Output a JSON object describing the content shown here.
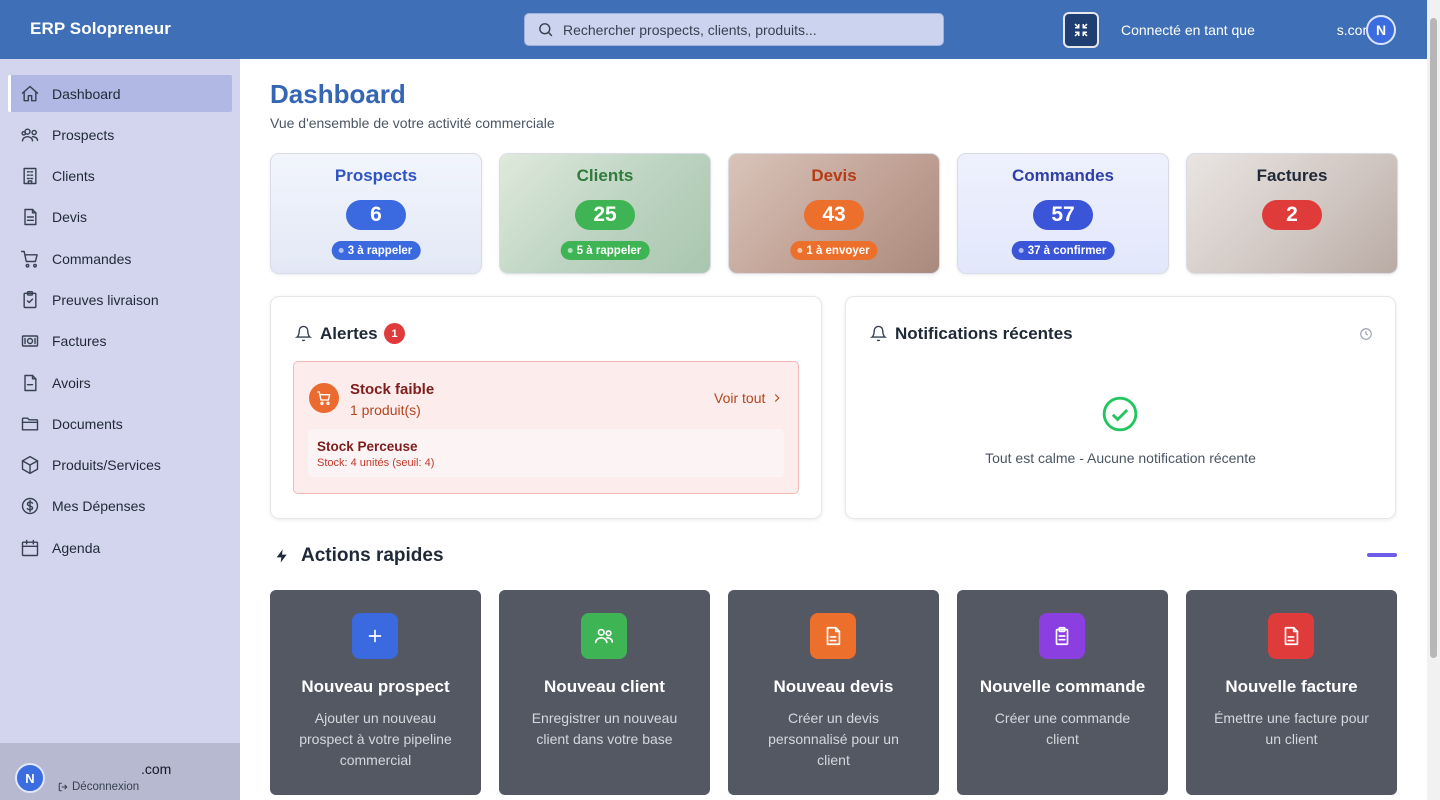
{
  "app": {
    "title": "ERP Solopreneur"
  },
  "search": {
    "placeholder": "Rechercher prospects, clients, produits..."
  },
  "user": {
    "connected_prefix": "Connecté en tant que ",
    "email_suffix": "s.com",
    "initial": "N",
    "sidebar_email_suffix": ".com",
    "logout_label": "Déconnexion"
  },
  "sidebar": {
    "items": [
      {
        "label": "Dashboard",
        "icon": "home-icon",
        "active": true
      },
      {
        "label": "Prospects",
        "icon": "users-icon"
      },
      {
        "label": "Clients",
        "icon": "building-icon"
      },
      {
        "label": "Devis",
        "icon": "file-icon"
      },
      {
        "label": "Commandes",
        "icon": "cart-icon"
      },
      {
        "label": "Preuves livraison",
        "icon": "clipboard-check-icon"
      },
      {
        "label": "Factures",
        "icon": "banknote-icon"
      },
      {
        "label": "Avoirs",
        "icon": "file-minus-icon"
      },
      {
        "label": "Documents",
        "icon": "folder-icon"
      },
      {
        "label": "Produits/Services",
        "icon": "box-icon"
      },
      {
        "label": "Mes Dépenses",
        "icon": "dollar-circle-icon"
      },
      {
        "label": "Agenda",
        "icon": "calendar-icon"
      }
    ]
  },
  "page": {
    "title": "Dashboard",
    "subtitle": "Vue d'ensemble de votre activité commerciale"
  },
  "stats": [
    {
      "label": "Prospects",
      "count": "6",
      "badge": "3 à rappeler",
      "color": "#3b6ae0",
      "title_color": "#2f55c2"
    },
    {
      "label": "Clients",
      "count": "25",
      "badge": "5 à rappeler",
      "color": "#3fb454",
      "title_color": "#2f7a3c"
    },
    {
      "label": "Devis",
      "count": "43",
      "badge": "1 à envoyer",
      "color": "#ec6f2b",
      "title_color": "#b53c16"
    },
    {
      "label": "Commandes",
      "count": "57",
      "badge": "37 à confirmer",
      "color": "#3b55d9",
      "title_color": "#3140a8"
    },
    {
      "label": "Factures",
      "count": "2",
      "badge": "",
      "color": "#e03b3b",
      "title_color": "#1f2937"
    }
  ],
  "alerts": {
    "title": "Alertes",
    "count": "1",
    "item_title": "Stock faible",
    "item_sub": "1 produit(s)",
    "see_all": "Voir tout",
    "detail_title": "Stock Perceuse",
    "detail_sub": "Stock: 4 unités (seuil: 4)"
  },
  "notifications": {
    "title": "Notifications récentes",
    "empty": "Tout est calme - Aucune notification récente"
  },
  "quick_actions": {
    "title": "Actions rapides",
    "items": [
      {
        "title": "Nouveau prospect",
        "desc": "Ajouter un nouveau prospect à votre pipeline commercial",
        "color": "#3b6ae0",
        "icon": "plus-icon"
      },
      {
        "title": "Nouveau client",
        "desc": "Enregistrer un nouveau client dans votre base",
        "color": "#3fb454",
        "icon": "users-icon"
      },
      {
        "title": "Nouveau devis",
        "desc": "Créer un devis personnalisé pour un client",
        "color": "#ec6f2b",
        "icon": "file-icon"
      },
      {
        "title": "Nouvelle commande",
        "desc": "Créer une commande client",
        "color": "#8b3fe0",
        "icon": "clipboard-icon"
      },
      {
        "title": "Nouvelle facture",
        "desc": "Émettre une facture pour un client",
        "color": "#e03b3b",
        "icon": "invoice-icon"
      }
    ]
  }
}
